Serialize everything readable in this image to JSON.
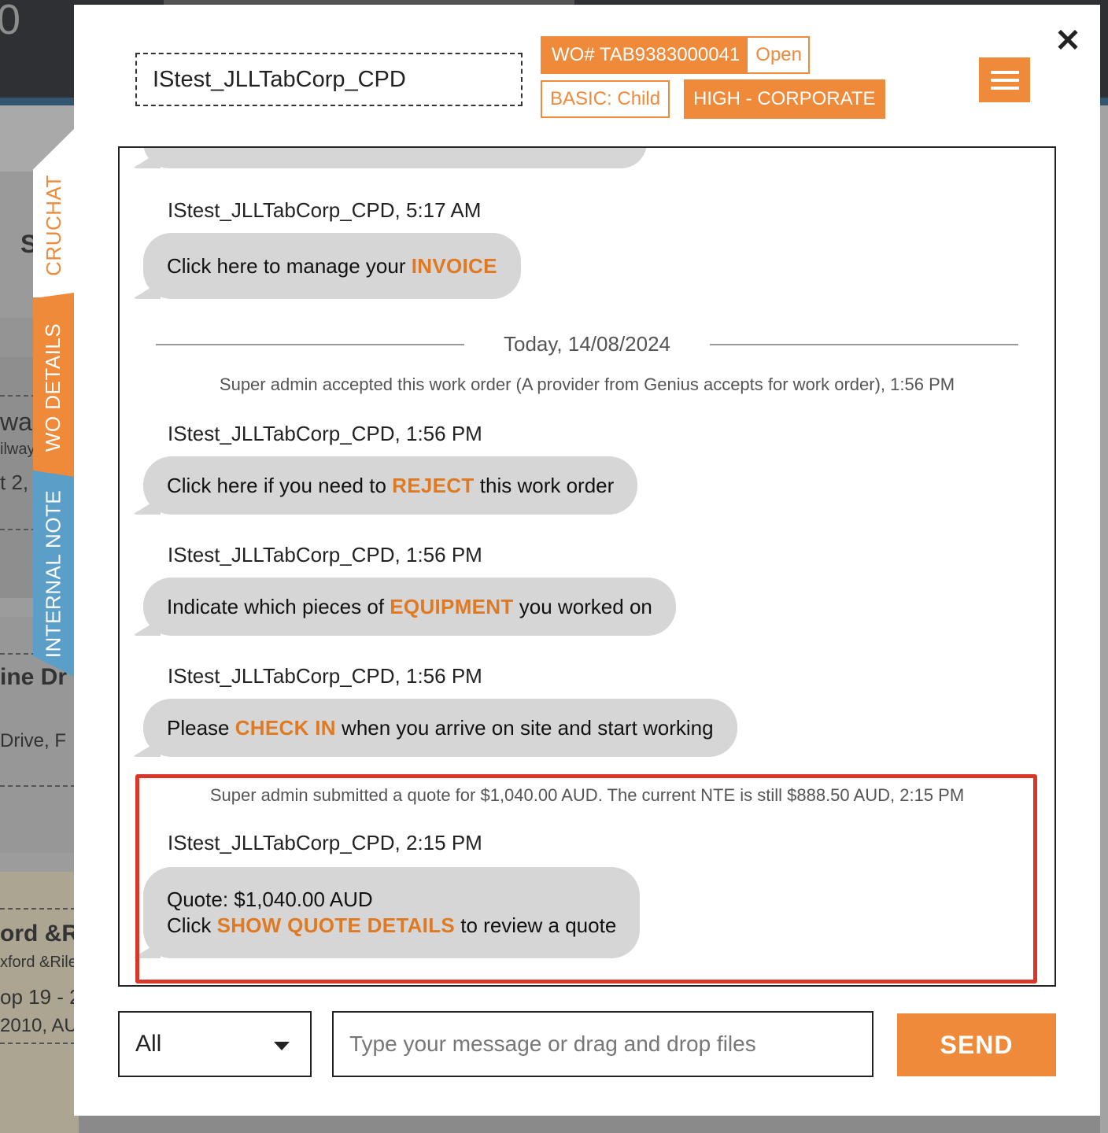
{
  "background": {
    "top_digit": "0",
    "snippets": [
      "S",
      "wa",
      "ilway",
      "t 2,",
      "ine Dr",
      "Drive, F",
      "ord &R",
      "xford &Rile",
      "op 19 - 2",
      "2010, AU"
    ]
  },
  "header": {
    "title": "IStest_JLLTabCorp_CPD",
    "wo_number": "WO# TAB9383000041",
    "wo_status": "Open",
    "type_badge": "BASIC: Child",
    "priority_badge": "HIGH - CORPORATE",
    "menu_icon": "hamburger-icon",
    "close_label": "✕"
  },
  "side_tabs": [
    {
      "label": "CRUCHAT",
      "color": "#ffffff"
    },
    {
      "label": "WO DETAILS",
      "color": "#ee8a3a"
    },
    {
      "label": "INTERNAL NOTE",
      "color": "#5b9ec8"
    }
  ],
  "chat": {
    "messages": [
      {
        "sender": "IStest_JLLTabCorp_CPD, 5:17 AM",
        "pre": "Click here to manage your ",
        "kw": "INVOICE",
        "post": ""
      },
      {
        "sender": "IStest_JLLTabCorp_CPD, 1:56 PM",
        "pre": "Click here if you need to ",
        "kw": "REJECT",
        "post": " this work order"
      },
      {
        "sender": "IStest_JLLTabCorp_CPD, 1:56 PM",
        "pre": "Indicate which pieces of ",
        "kw": "EQUIPMENT",
        "post": " you worked on"
      },
      {
        "sender": "IStest_JLLTabCorp_CPD, 1:56 PM",
        "pre": "Please ",
        "kw": "CHECK IN",
        "post": " when you arrive on site and start working"
      },
      {
        "sender": "IStest_JLLTabCorp_CPD, 2:15 PM",
        "line1": "Quote: $1,040.00 AUD",
        "pre": "Click ",
        "kw": "SHOW QUOTE DETAILS",
        "post": " to review a quote"
      }
    ],
    "date_separator": "Today, 14/08/2024",
    "system_accept": "Super admin accepted this work order (A provider from Genius accepts for work order), 1:56 PM",
    "system_quote": "Super admin submitted a quote for $1,040.00 AUD. The current NTE is still $888.50 AUD, 2:15 PM"
  },
  "footer": {
    "filter_value": "All",
    "input_placeholder": "Type your message or drag and drop files",
    "send_label": "SEND"
  },
  "colors": {
    "accent": "#ee8a3a",
    "keyword": "#e07a22",
    "highlight": "#d8372a",
    "internal_note": "#5b9ec8"
  }
}
